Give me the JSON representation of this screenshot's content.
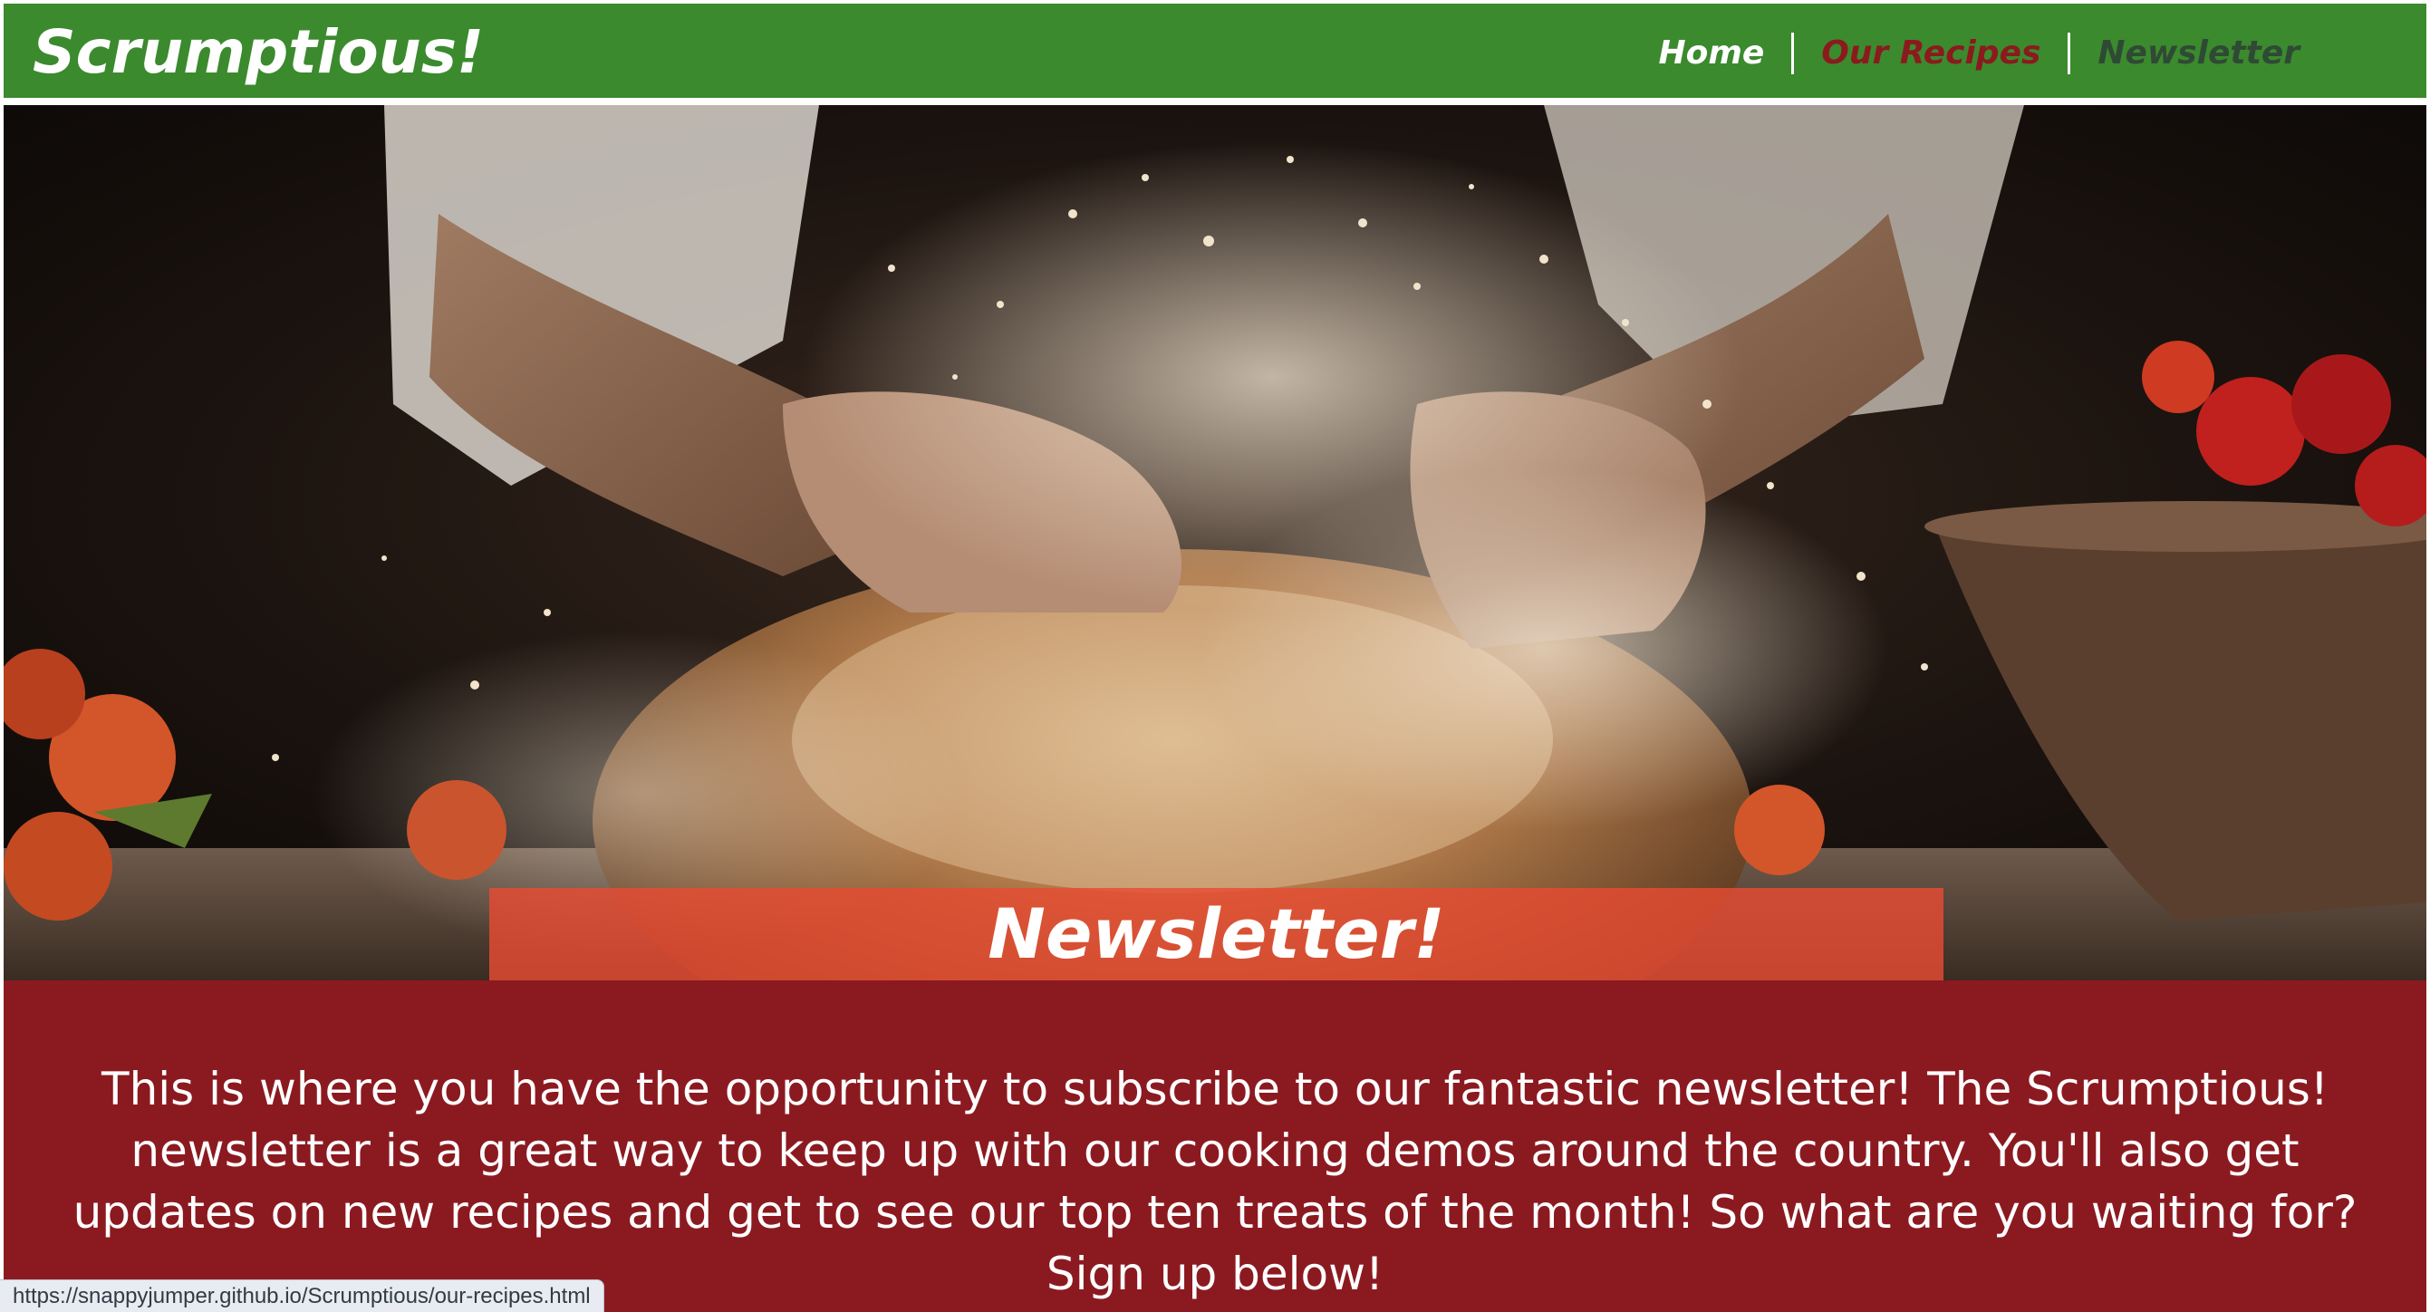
{
  "header": {
    "brand": "Scrumptious!",
    "nav": [
      {
        "label": "Home",
        "color": "#ffffff"
      },
      {
        "label": "Our Recipes",
        "color": "#8b1a1e"
      },
      {
        "label": "Newsletter",
        "color": "#2f4a34"
      }
    ]
  },
  "hero": {
    "title": "Newsletter!"
  },
  "intro": {
    "text": "This is where you have the opportunity to subscribe to our fantastic newsletter! The Scrumptious! newsletter is a great way to keep up with our cooking demos around the country. You'll also get updates on new recipes and get to see our top ten treats of the month! So what are you waiting for? Sign up below!"
  },
  "status_bar": {
    "url": "https://snappyjumper.github.io/Scrumptious/our-recipes.html"
  },
  "colors": {
    "header_green": "#3b8a2e",
    "intro_red": "#8b1a20",
    "title_banner": "#e74c32"
  }
}
